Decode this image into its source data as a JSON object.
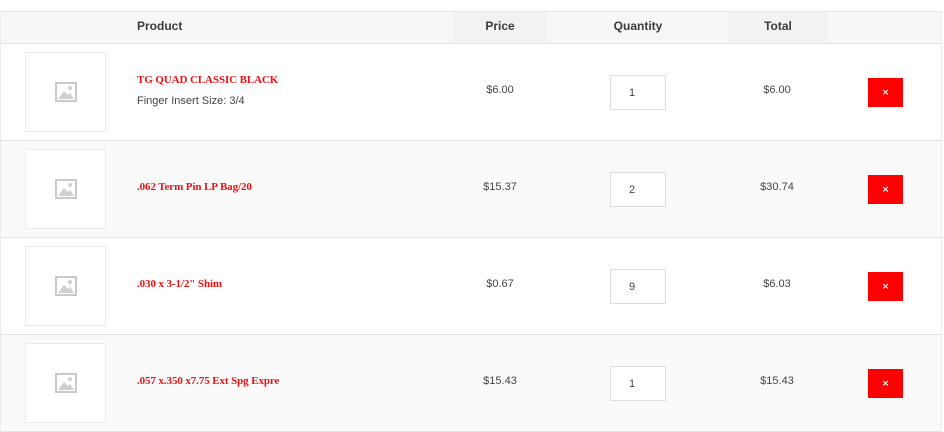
{
  "header": {
    "product": "Product",
    "price": "Price",
    "quantity": "Quantity",
    "total": "Total"
  },
  "items": [
    {
      "name": "TG QUAD CLASSIC BLACK",
      "meta_label": "Finger Insert Size:",
      "meta_value": "3/4",
      "price": "$6.00",
      "quantity": "1",
      "total": "$6.00",
      "remove_label": "×",
      "thumbnail_icon": "image-placeholder-icon"
    },
    {
      "name": ".062 Term Pin LP Bag/20",
      "price": "$15.37",
      "quantity": "2",
      "total": "$30.74",
      "remove_label": "×",
      "thumbnail_icon": "image-placeholder-icon"
    },
    {
      "name": ".030 x 3-1/2\" Shim",
      "price": "$0.67",
      "quantity": "9",
      "total": "$6.03",
      "remove_label": "×",
      "thumbnail_icon": "image-placeholder-icon"
    },
    {
      "name": ".057 x.350 x7.75 Ext Spg Expre",
      "price": "$15.43",
      "quantity": "1",
      "total": "$15.43",
      "remove_label": "×",
      "thumbnail_icon": "image-placeholder-icon"
    }
  ],
  "colors": {
    "accent": "#ff0000",
    "product_link": "#ee1111",
    "header_bg": "#f7f7f7",
    "row_alt_bg": "#fafafa"
  }
}
